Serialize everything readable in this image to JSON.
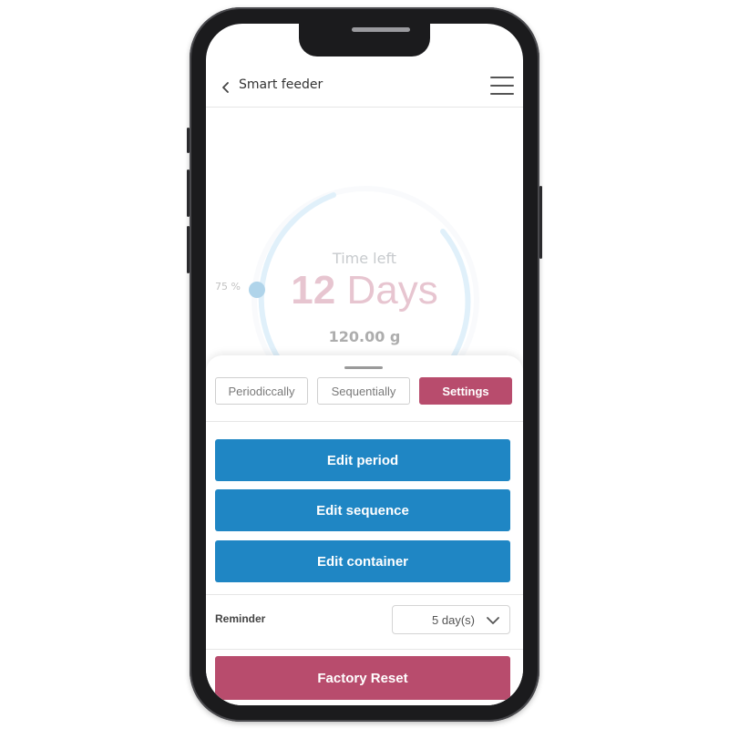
{
  "header": {
    "title": "Smart feeder"
  },
  "icons": {
    "back": "chevron-left-icon",
    "menu": "hamburger-menu-icon",
    "dropdown": "chevron-down-icon"
  },
  "gauge": {
    "label": "Time left",
    "days_number": "12",
    "days_unit": "Days",
    "weight": "120.00 g",
    "percent_label": "75 %",
    "level": 0.75
  },
  "tabs": [
    {
      "label": "Periodiccally",
      "active": false
    },
    {
      "label": "Sequentially",
      "active": false
    },
    {
      "label": "Settings",
      "active": true
    }
  ],
  "actions": {
    "edit_period": "Edit period",
    "edit_sequence": "Edit sequence",
    "edit_container": "Edit container"
  },
  "reminder": {
    "label": "Reminder",
    "value": "5 day(s)"
  },
  "factory_reset": "Factory Reset",
  "colors": {
    "primary_blue": "#1f86c4",
    "accent_pink": "#b84c6d"
  }
}
